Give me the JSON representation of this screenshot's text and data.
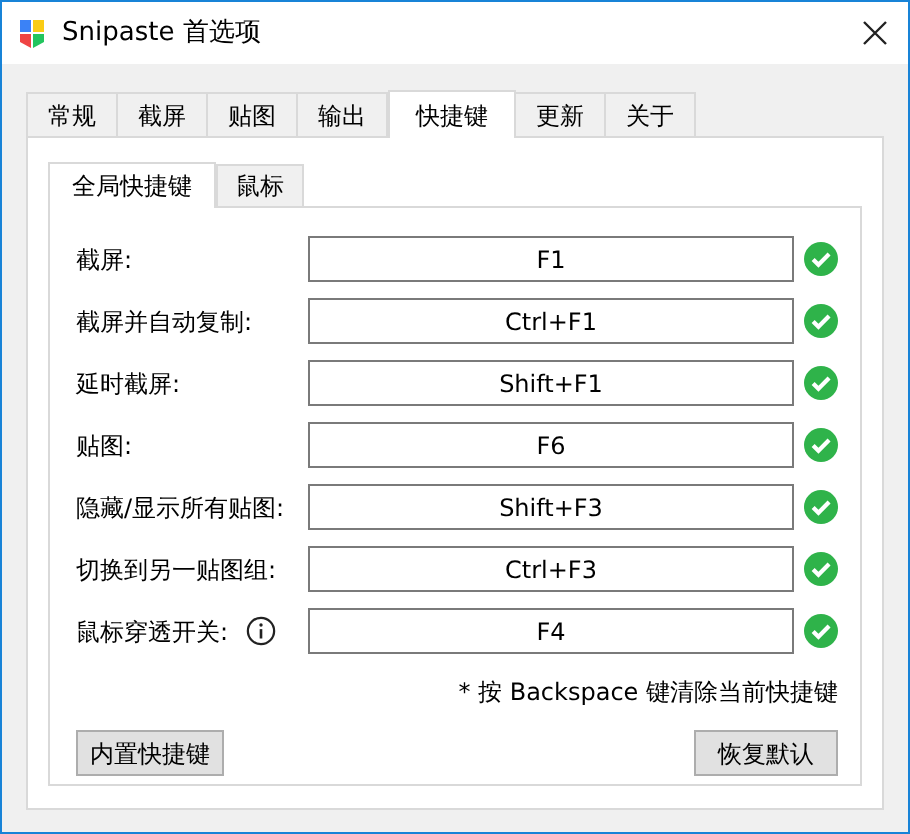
{
  "window": {
    "title": "Snipaste 首选项"
  },
  "tabs": [
    {
      "label": "常规",
      "selected": false
    },
    {
      "label": "截屏",
      "selected": false
    },
    {
      "label": "贴图",
      "selected": false
    },
    {
      "label": "输出",
      "selected": false
    },
    {
      "label": "快捷键",
      "selected": true
    },
    {
      "label": "更新",
      "selected": false
    },
    {
      "label": "关于",
      "selected": false
    }
  ],
  "subtabs": [
    {
      "label": "全局快捷键",
      "selected": true
    },
    {
      "label": "鼠标",
      "selected": false
    }
  ],
  "shortcuts": [
    {
      "label": "截屏:",
      "value": "F1",
      "valid": true,
      "info": false
    },
    {
      "label": "截屏并自动复制:",
      "value": "Ctrl+F1",
      "valid": true,
      "info": false
    },
    {
      "label": "延时截屏:",
      "value": "Shift+F1",
      "valid": true,
      "info": false
    },
    {
      "label": "贴图:",
      "value": "F6",
      "valid": true,
      "info": false
    },
    {
      "label": "隐藏/显示所有贴图:",
      "value": "Shift+F3",
      "valid": true,
      "info": false
    },
    {
      "label": "切换到另一贴图组:",
      "value": "Ctrl+F3",
      "valid": true,
      "info": false
    },
    {
      "label": "鼠标穿透开关:",
      "value": "F4",
      "valid": true,
      "info": true
    }
  ],
  "note": "* 按 Backspace 键清除当前快捷键",
  "buttons": [
    "内置快捷键",
    "恢复默认"
  ]
}
